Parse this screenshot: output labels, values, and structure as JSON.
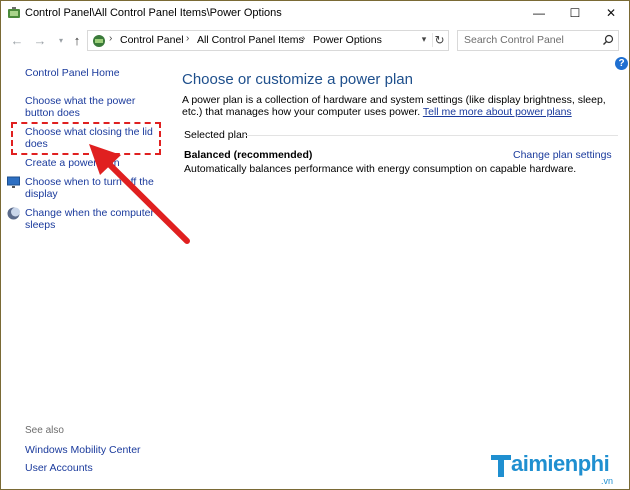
{
  "window": {
    "title": "Control Panel\\All Control Panel Items\\Power Options",
    "minimize_glyph": "—",
    "maximize_glyph": "☐",
    "close_glyph": "✕"
  },
  "address_bar": {
    "crumbs": [
      "Control Panel",
      "All Control Panel Items",
      "Power Options"
    ],
    "separator": "›",
    "search_placeholder": "Search Control Panel"
  },
  "sidebar": {
    "home": "Control Panel Home",
    "items": [
      {
        "label": "Choose what the power button does",
        "icon": "none"
      },
      {
        "label": "Choose what closing the lid does",
        "icon": "none"
      },
      {
        "label": "Create a power plan",
        "icon": "none"
      },
      {
        "label": "Choose when to turn off the display",
        "icon": "monitor-icon"
      },
      {
        "label": "Change when the computer sleeps",
        "icon": "moon-icon"
      }
    ],
    "see_also": "See also",
    "see_also_links": [
      "Windows Mobility Center",
      "User Accounts"
    ]
  },
  "main": {
    "heading": "Choose or customize a power plan",
    "description": "A power plan is a collection of hardware and system settings (like display brightness, sleep, etc.) that manages how your computer uses power.",
    "description_link": "Tell me more about power plans",
    "selected_plan_label": "Selected plan",
    "plan_name": "Balanced (recommended)",
    "plan_change_link": "Change plan settings",
    "plan_description": "Automatically balances performance with energy consumption on capable hardware.",
    "help_glyph": "?"
  },
  "watermark": {
    "text": "aimienphi",
    "suffix": ".vn"
  },
  "colors": {
    "link": "#1a3a9c",
    "heading": "#1e4f8c",
    "annotation": "#e02020",
    "watermark": "#1f8fd0"
  }
}
